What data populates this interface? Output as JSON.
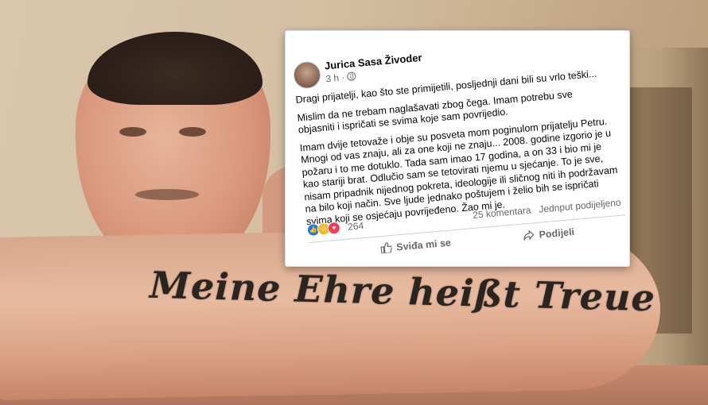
{
  "photo": {
    "tattoo_text": "Meine Ehre heißt Treue"
  },
  "post": {
    "author": "Jurica Sasa Živoder",
    "time": "3 h ·",
    "paragraphs": [
      "Dragi prijatelji, kao što ste primijetili, posljednji dani bili su vrlo teški...",
      "Mislim da ne trebam naglašavati zbog čega. Imam potrebu sve objasniti i ispričati se svima koje sam povrijedio.",
      "Imam dvije tetovaže i obje su posveta mom poginulom prijatelju Petru. Mnogi od vas znaju, ali za one koji ne znaju... 2008. godine izgorio je u požaru i to me dotuklo. Tada sam imao 17 godina, a on 33 i bio mi je kao stariji brat. Odlučio sam se tetovirati njemu u sjećanje. To je sve, nisam pripadnik nijednog pokreta, ideologije ili sličnog niti ih podržavam na bilo koji način. Sve ljude jednako poštujem i želio bih se ispričati svima koji se osjećaju povrijeđeno. Žao mi je."
    ],
    "reaction_count": "264",
    "comments": "25 komentara",
    "shares": "Jednput podijeljeno",
    "like_label": "Sviđa mi se",
    "share_label": "Podijeli",
    "colors": {
      "like_blue": "#1877f2",
      "care_yellow": "#f7b928",
      "love_red": "#f33e58"
    }
  }
}
